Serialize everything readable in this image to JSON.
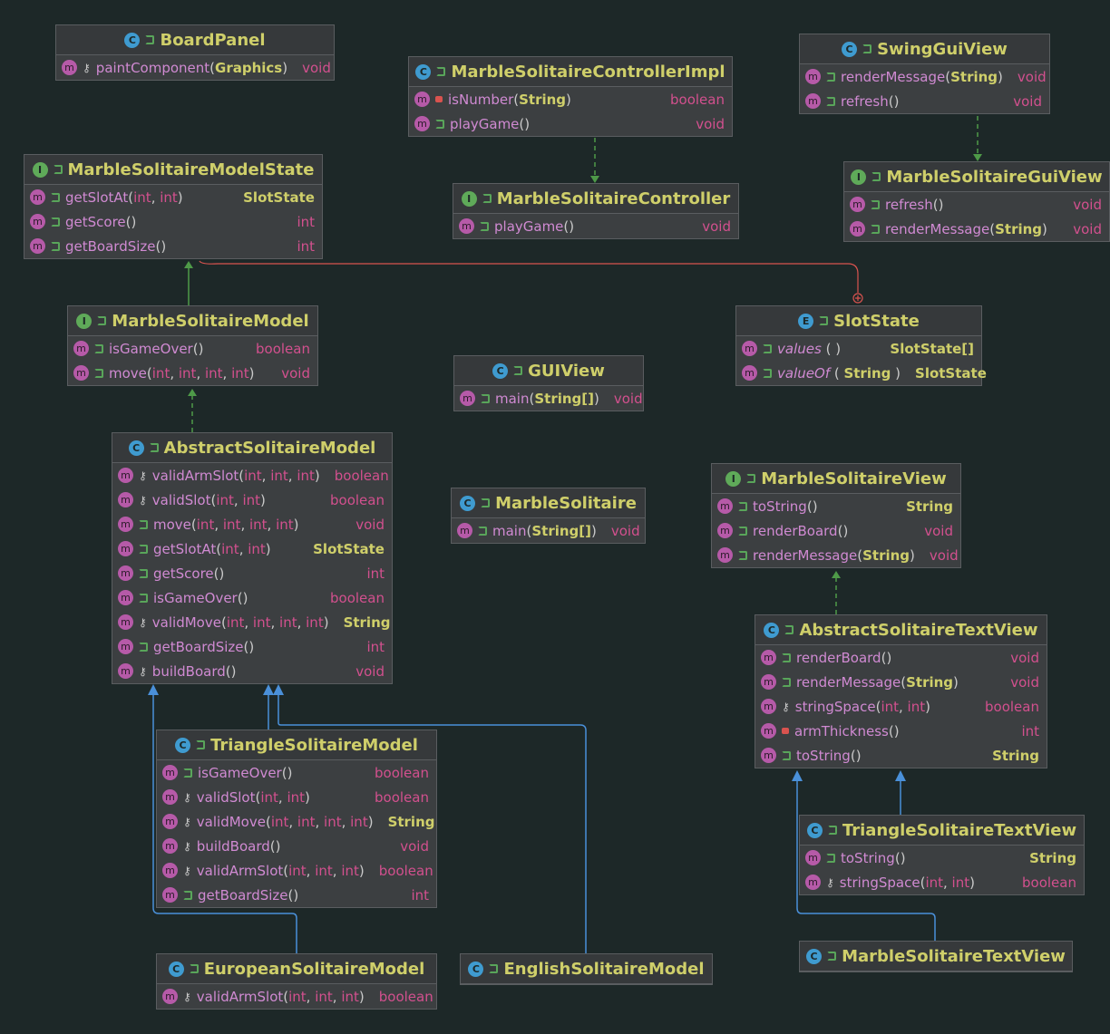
{
  "classes": [
    {
      "kind": "C",
      "name": "BoardPanel",
      "methods": [
        {
          "name": "paintComponent",
          "params": [
            "Graphics"
          ],
          "ret": "void",
          "vis": "key"
        }
      ]
    },
    {
      "kind": "C",
      "name": "MarbleSolitaireControllerImpl",
      "methods": [
        {
          "name": "isNumber",
          "params": [
            "String"
          ],
          "ret": "boolean",
          "vis": "priv"
        },
        {
          "name": "playGame",
          "params": [],
          "ret": "void",
          "vis": "pub"
        }
      ]
    },
    {
      "kind": "C",
      "name": "SwingGuiView",
      "methods": [
        {
          "name": "renderMessage",
          "params": [
            "String"
          ],
          "ret": "void",
          "vis": "pub"
        },
        {
          "name": "refresh",
          "params": [],
          "ret": "void",
          "vis": "pub"
        }
      ]
    },
    {
      "kind": "I",
      "name": "MarbleSolitaireModelState",
      "methods": [
        {
          "name": "getSlotAt",
          "params": [
            "int",
            "int"
          ],
          "ret": "SlotState",
          "vis": "pub"
        },
        {
          "name": "getScore",
          "params": [],
          "ret": "int",
          "vis": "pub"
        },
        {
          "name": "getBoardSize",
          "params": [],
          "ret": "int",
          "vis": "pub"
        }
      ]
    },
    {
      "kind": "I",
      "name": "MarbleSolitaireController",
      "methods": [
        {
          "name": "playGame",
          "params": [],
          "ret": "void",
          "vis": "pub"
        }
      ]
    },
    {
      "kind": "I",
      "name": "MarbleSolitaireGuiView",
      "methods": [
        {
          "name": "refresh",
          "params": [],
          "ret": "void",
          "vis": "pub"
        },
        {
          "name": "renderMessage",
          "params": [
            "String"
          ],
          "ret": "void",
          "vis": "pub"
        }
      ]
    },
    {
      "kind": "I",
      "name": "MarbleSolitaireModel",
      "methods": [
        {
          "name": "isGameOver",
          "params": [],
          "ret": "boolean",
          "vis": "pub"
        },
        {
          "name": "move",
          "params": [
            "int",
            "int",
            "int",
            "int"
          ],
          "ret": "void",
          "vis": "pub"
        }
      ]
    },
    {
      "kind": "E",
      "name": "SlotState",
      "methods": [
        {
          "name": "values",
          "params": [],
          "ret": "SlotState[]",
          "vis": "pub",
          "italic": true
        },
        {
          "name": "valueOf",
          "params": [
            "String"
          ],
          "ret": "SlotState",
          "vis": "pub",
          "italic": true
        }
      ]
    },
    {
      "kind": "C",
      "name": "GUIView",
      "methods": [
        {
          "name": "main",
          "params": [
            "String[]"
          ],
          "ret": "void",
          "vis": "pub"
        }
      ]
    },
    {
      "kind": "C",
      "name": "AbstractSolitaireModel",
      "methods": [
        {
          "name": "validArmSlot",
          "params": [
            "int",
            "int",
            "int"
          ],
          "ret": "boolean",
          "vis": "key"
        },
        {
          "name": "validSlot",
          "params": [
            "int",
            "int"
          ],
          "ret": "boolean",
          "vis": "key"
        },
        {
          "name": "move",
          "params": [
            "int",
            "int",
            "int",
            "int"
          ],
          "ret": "void",
          "vis": "pub"
        },
        {
          "name": "getSlotAt",
          "params": [
            "int",
            "int"
          ],
          "ret": "SlotState",
          "vis": "pub"
        },
        {
          "name": "getScore",
          "params": [],
          "ret": "int",
          "vis": "pub"
        },
        {
          "name": "isGameOver",
          "params": [],
          "ret": "boolean",
          "vis": "pub"
        },
        {
          "name": "validMove",
          "params": [
            "int",
            "int",
            "int",
            "int"
          ],
          "ret": "String",
          "vis": "key"
        },
        {
          "name": "getBoardSize",
          "params": [],
          "ret": "int",
          "vis": "pub"
        },
        {
          "name": "buildBoard",
          "params": [],
          "ret": "void",
          "vis": "key"
        }
      ]
    },
    {
      "kind": "C",
      "name": "MarbleSolitaire",
      "methods": [
        {
          "name": "main",
          "params": [
            "String[]"
          ],
          "ret": "void",
          "vis": "pub"
        }
      ]
    },
    {
      "kind": "I",
      "name": "MarbleSolitaireView",
      "methods": [
        {
          "name": "toString",
          "params": [],
          "ret": "String",
          "vis": "pub"
        },
        {
          "name": "renderBoard",
          "params": [],
          "ret": "void",
          "vis": "pub"
        },
        {
          "name": "renderMessage",
          "params": [
            "String"
          ],
          "ret": "void",
          "vis": "pub"
        }
      ]
    },
    {
      "kind": "C",
      "name": "AbstractSolitaireTextView",
      "methods": [
        {
          "name": "renderBoard",
          "params": [],
          "ret": "void",
          "vis": "pub"
        },
        {
          "name": "renderMessage",
          "params": [
            "String"
          ],
          "ret": "void",
          "vis": "pub"
        },
        {
          "name": "stringSpace",
          "params": [
            "int",
            "int"
          ],
          "ret": "boolean",
          "vis": "key"
        },
        {
          "name": "armThickness",
          "params": [],
          "ret": "int",
          "vis": "priv"
        },
        {
          "name": "toString",
          "params": [],
          "ret": "String",
          "vis": "pub"
        }
      ]
    },
    {
      "kind": "C",
      "name": "TriangleSolitaireModel",
      "methods": [
        {
          "name": "isGameOver",
          "params": [],
          "ret": "boolean",
          "vis": "pub"
        },
        {
          "name": "validSlot",
          "params": [
            "int",
            "int"
          ],
          "ret": "boolean",
          "vis": "key"
        },
        {
          "name": "validMove",
          "params": [
            "int",
            "int",
            "int",
            "int"
          ],
          "ret": "String",
          "vis": "key"
        },
        {
          "name": "buildBoard",
          "params": [],
          "ret": "void",
          "vis": "key"
        },
        {
          "name": "validArmSlot",
          "params": [
            "int",
            "int",
            "int"
          ],
          "ret": "boolean",
          "vis": "key"
        },
        {
          "name": "getBoardSize",
          "params": [],
          "ret": "int",
          "vis": "pub"
        }
      ]
    },
    {
      "kind": "C",
      "name": "TriangleSolitaireTextView",
      "methods": [
        {
          "name": "toString",
          "params": [],
          "ret": "String",
          "vis": "pub"
        },
        {
          "name": "stringSpace",
          "params": [
            "int",
            "int"
          ],
          "ret": "boolean",
          "vis": "key"
        }
      ]
    },
    {
      "kind": "C",
      "name": "EuropeanSolitaireModel",
      "methods": [
        {
          "name": "validArmSlot",
          "params": [
            "int",
            "int",
            "int"
          ],
          "ret": "boolean",
          "vis": "key"
        }
      ]
    },
    {
      "kind": "C",
      "name": "EnglishSolitaireModel",
      "methods": []
    },
    {
      "kind": "C",
      "name": "MarbleSolitaireTextView",
      "methods": []
    }
  ],
  "colors": {
    "realization": "#4e9a48",
    "generalization": "#4a90d9",
    "inner": "#d9534f"
  }
}
